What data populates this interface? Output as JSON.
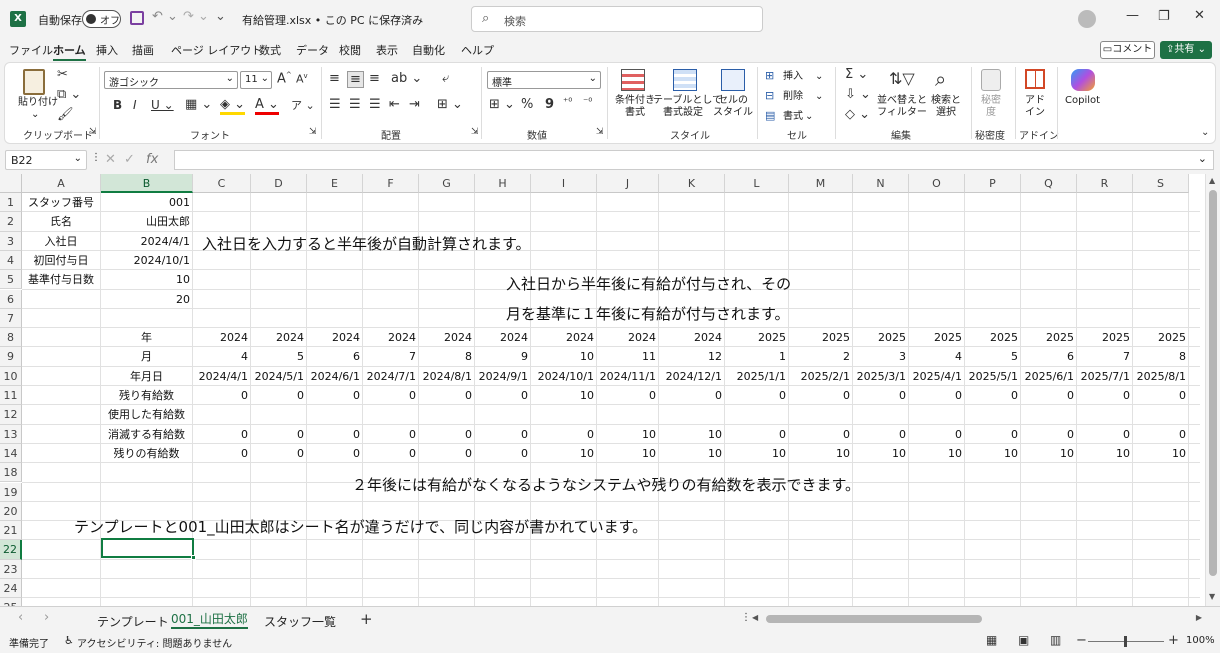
{
  "titlebar": {
    "app_icon": "excel-icon",
    "autosave_label": "自動保存",
    "autosave_state": "オフ",
    "filename": "有給管理.xlsx • この PC に保存済み",
    "search_placeholder": "検索"
  },
  "ribbon_tabs": [
    "ファイル",
    "ホーム",
    "挿入",
    "描画",
    "ページ レイアウト",
    "数式",
    "データ",
    "校閲",
    "表示",
    "自動化",
    "ヘルプ"
  ],
  "active_tab": "ホーム",
  "header_buttons": {
    "comment": "コメント",
    "share": "共有"
  },
  "ribbon": {
    "clipboard": {
      "paste": "貼り付け",
      "label": "クリップボード"
    },
    "font": {
      "name": "游ゴシック",
      "size": "11",
      "label": "フォント"
    },
    "alignment": {
      "label": "配置"
    },
    "number": {
      "format": "標準",
      "label": "数値"
    },
    "styles": {
      "conditional": "条件付き\n書式",
      "table": "テーブルとして\n書式設定",
      "cell_style": "セルの\nスタイル",
      "label": "スタイル"
    },
    "cells": {
      "insert": "挿入",
      "delete": "削除",
      "format": "書式",
      "label": "セル"
    },
    "editing": {
      "sort": "並べ替えと\nフィルター",
      "find": "検索と\n選択",
      "label": "編集"
    },
    "sensitivity": {
      "btn": "秘密\n度",
      "label": "秘密度"
    },
    "addins": {
      "btn": "アド\nイン",
      "label": "アドイン"
    },
    "copilot": {
      "btn": "Copilot"
    }
  },
  "formula_bar": {
    "name_box": "B22",
    "formula": ""
  },
  "columns": [
    "A",
    "B",
    "C",
    "D",
    "E",
    "F",
    "G",
    "H",
    "I",
    "J",
    "K",
    "L",
    "M",
    "N",
    "O",
    "P",
    "Q",
    "R",
    "S"
  ],
  "rows": [
    "1",
    "2",
    "3",
    "4",
    "5",
    "6",
    "7",
    "8",
    "9",
    "10",
    "11",
    "12",
    "13",
    "14",
    "18",
    "19",
    "20",
    "21",
    "22",
    "23",
    "24",
    "25"
  ],
  "cells": {
    "A1": "スタッフ番号",
    "B1": "001",
    "A2": "氏名",
    "B2": "山田太郎",
    "A3": "入社日",
    "B3": "2024/4/1",
    "A4": "初回付与日",
    "B4": "2024/10/1",
    "A5": "基準付与日数",
    "B5": "10",
    "B6": "20",
    "B8": "年",
    "B9": "月",
    "B10": "年月日",
    "B11": "残り有給数",
    "B12": "使用した有給数",
    "B13": "消滅する有給数",
    "B14": "残りの有給数"
  },
  "table": {
    "years": [
      "2024",
      "2024",
      "2024",
      "2024",
      "2024",
      "2024",
      "2024",
      "2024",
      "2024",
      "2025",
      "2025",
      "2025",
      "2025",
      "2025",
      "2025",
      "2025",
      "2025"
    ],
    "months": [
      "4",
      "5",
      "6",
      "7",
      "8",
      "9",
      "10",
      "11",
      "12",
      "1",
      "2",
      "3",
      "4",
      "5",
      "6",
      "7",
      "8"
    ],
    "dates": [
      "2024/4/1",
      "2024/5/1",
      "2024/6/1",
      "2024/7/1",
      "2024/8/1",
      "2024/9/1",
      "2024/10/1",
      "2024/11/1",
      "2024/12/1",
      "2025/1/1",
      "2025/2/1",
      "2025/3/1",
      "2025/4/1",
      "2025/5/1",
      "2025/6/1",
      "2025/7/1",
      "2025/8/1"
    ],
    "remaining": [
      "0",
      "0",
      "0",
      "0",
      "0",
      "0",
      "10",
      "0",
      "0",
      "0",
      "0",
      "0",
      "0",
      "0",
      "0",
      "0",
      "0"
    ],
    "expiring": [
      "0",
      "0",
      "0",
      "0",
      "0",
      "0",
      "0",
      "10",
      "10",
      "0",
      "0",
      "0",
      "0",
      "0",
      "0",
      "0",
      "0"
    ],
    "remaining_final": [
      "0",
      "0",
      "0",
      "0",
      "0",
      "0",
      "10",
      "10",
      "10",
      "10",
      "10",
      "10",
      "10",
      "10",
      "10",
      "10",
      "10"
    ]
  },
  "notes": {
    "n1": "入社日を入力すると半年後が自動計算されます。",
    "n2": "入社日から半年後に有給が付与され、その",
    "n3": "月を基準に１年後に有給が付与されます。",
    "n4": "２年後には有給がなくなるようなシステムや残りの有給数を表示できます。",
    "n5": "テンプレートと001_山田太郎はシート名が違うだけで、同じ内容が書かれています。"
  },
  "sheets": [
    "テンプレート",
    "001_山田太郎",
    "スタッフ一覧"
  ],
  "active_sheet": "001_山田太郎",
  "status": {
    "ready": "準備完了",
    "accessibility": "アクセシビリティ: 問題ありません",
    "zoom": "100%"
  },
  "colors": {
    "excel_green": "#1e7145",
    "selection": "#107c41"
  }
}
